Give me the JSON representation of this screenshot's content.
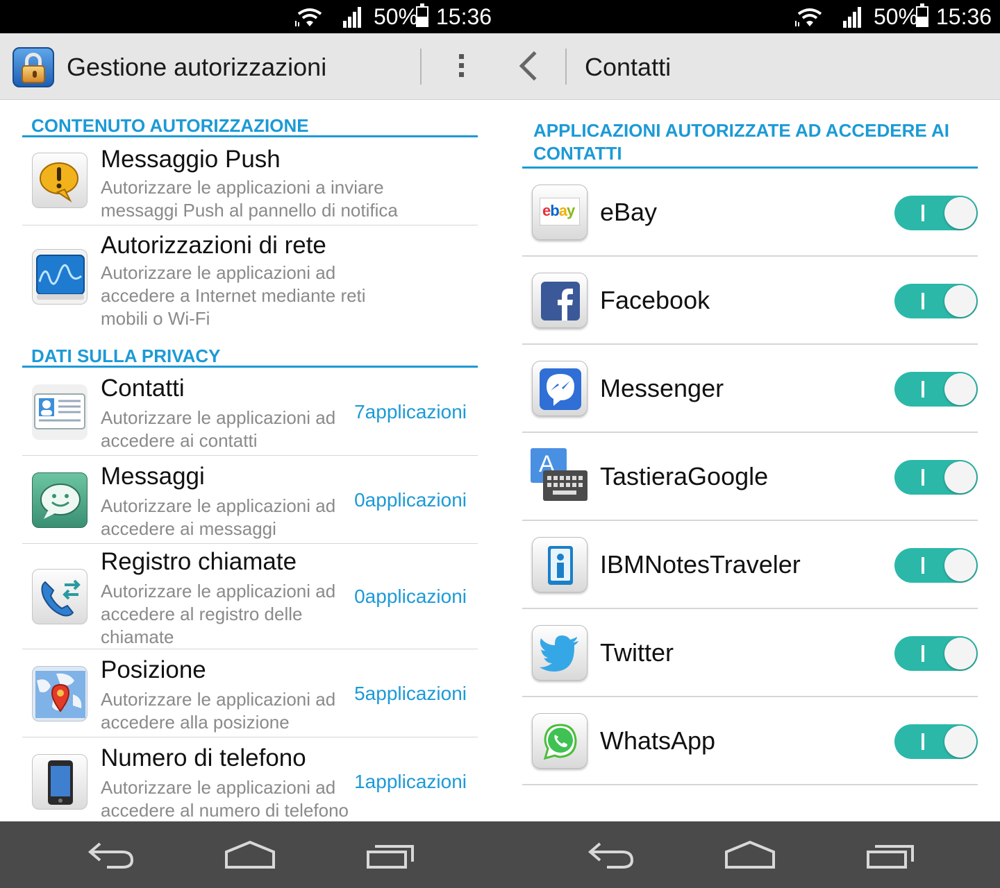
{
  "status_bar": {
    "battery_percent": "50%",
    "time": "15:36",
    "battery_level": 0.5
  },
  "left_panel": {
    "title": "Gestione autorizzazioni",
    "sections": {
      "permission_content": "CONTENUTO AUTORIZZAZIONE",
      "privacy_data": "DATI SULLA PRIVACY"
    },
    "items": {
      "push": {
        "title": "Messaggio Push",
        "desc1": "Autorizzare le applicazioni a inviare",
        "desc2": "messaggi Push al pannello di notifica"
      },
      "network": {
        "title": "Autorizzazioni di rete",
        "desc1": "Autorizzare le applicazioni ad",
        "desc2": "accedere a Internet mediante reti",
        "desc3": "mobili o Wi-Fi"
      },
      "contacts": {
        "title": "Contatti",
        "desc1": "Autorizzare le applicazioni ad",
        "desc2": "accedere ai contatti",
        "count": "7applicazioni"
      },
      "messages": {
        "title": "Messaggi",
        "desc1": "Autorizzare le applicazioni ad",
        "desc2": "accedere ai messaggi",
        "count": "0applicazioni"
      },
      "call_log": {
        "title": "Registro chiamate",
        "desc1": "Autorizzare le applicazioni ad",
        "desc2": "accedere al registro delle",
        "desc3": "chiamate",
        "count": "0applicazioni"
      },
      "location": {
        "title": "Posizione",
        "desc1": "Autorizzare le applicazioni ad",
        "desc2": "accedere alla posizione",
        "count": "5applicazioni"
      },
      "phone_number": {
        "title": "Numero di telefono",
        "desc1": "Autorizzare le applicazioni ad",
        "desc2": "accedere al numero di telefono",
        "count": "1applicazioni"
      }
    }
  },
  "right_panel": {
    "title": "Contatti",
    "section_line1": "APPLICAZIONI AUTORIZZATE AD ACCEDERE AI",
    "section_line2": "CONTATTI",
    "apps": [
      {
        "name": "eBay",
        "enabled": true
      },
      {
        "name": "Facebook",
        "enabled": true
      },
      {
        "name": "Messenger",
        "enabled": true
      },
      {
        "name": "TastieraGoogle",
        "enabled": true
      },
      {
        "name": "IBMNotesTraveler",
        "enabled": true
      },
      {
        "name": "Twitter",
        "enabled": true
      },
      {
        "name": "WhatsApp",
        "enabled": true
      }
    ],
    "ebay_logo_text": "ebay",
    "google_keyboard_letter": "A"
  },
  "colors": {
    "accent": "#1c9ad6",
    "toggle_on": "#2bb8a9",
    "action_bar": "#e6e6e6",
    "nav_bar": "#4a4a4a"
  },
  "icons": {
    "status": [
      "wifi-icon",
      "signal-icon",
      "battery-icon"
    ],
    "nav": [
      "back-icon",
      "home-icon",
      "recents-icon"
    ]
  }
}
